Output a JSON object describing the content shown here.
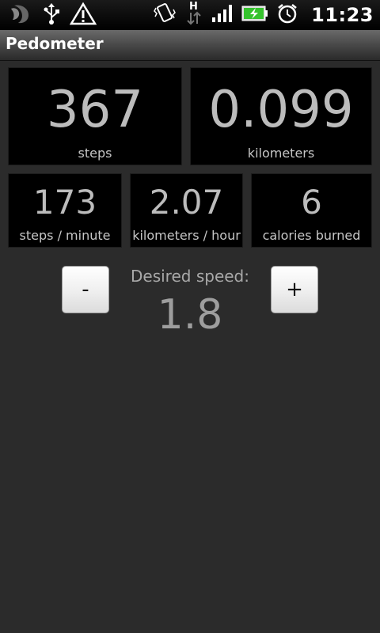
{
  "status_bar": {
    "time": "11:23",
    "icons": [
      "moon-notification-icon",
      "usb-icon",
      "warning-icon",
      "vibrate-icon",
      "hspa-data-icon",
      "signal-icon",
      "battery-charging-icon",
      "alarm-icon"
    ]
  },
  "app": {
    "title": "Pedometer"
  },
  "stats": {
    "steps": {
      "value": "367",
      "label": "steps"
    },
    "distance": {
      "value": "0.099",
      "label": "kilometers"
    },
    "pace": {
      "value": "173",
      "label": "steps / minute"
    },
    "speed": {
      "value": "2.07",
      "label": "kilometers / hour"
    },
    "calories": {
      "value": "6",
      "label": "calories burned"
    }
  },
  "desired_speed": {
    "label": "Desired speed:",
    "value": "1.8",
    "decrease_label": "-",
    "increase_label": "+"
  },
  "colors": {
    "background": "#2b2b2b",
    "tile": "#000000",
    "value_text": "#bcbcbc",
    "battery": "#35c22d"
  }
}
